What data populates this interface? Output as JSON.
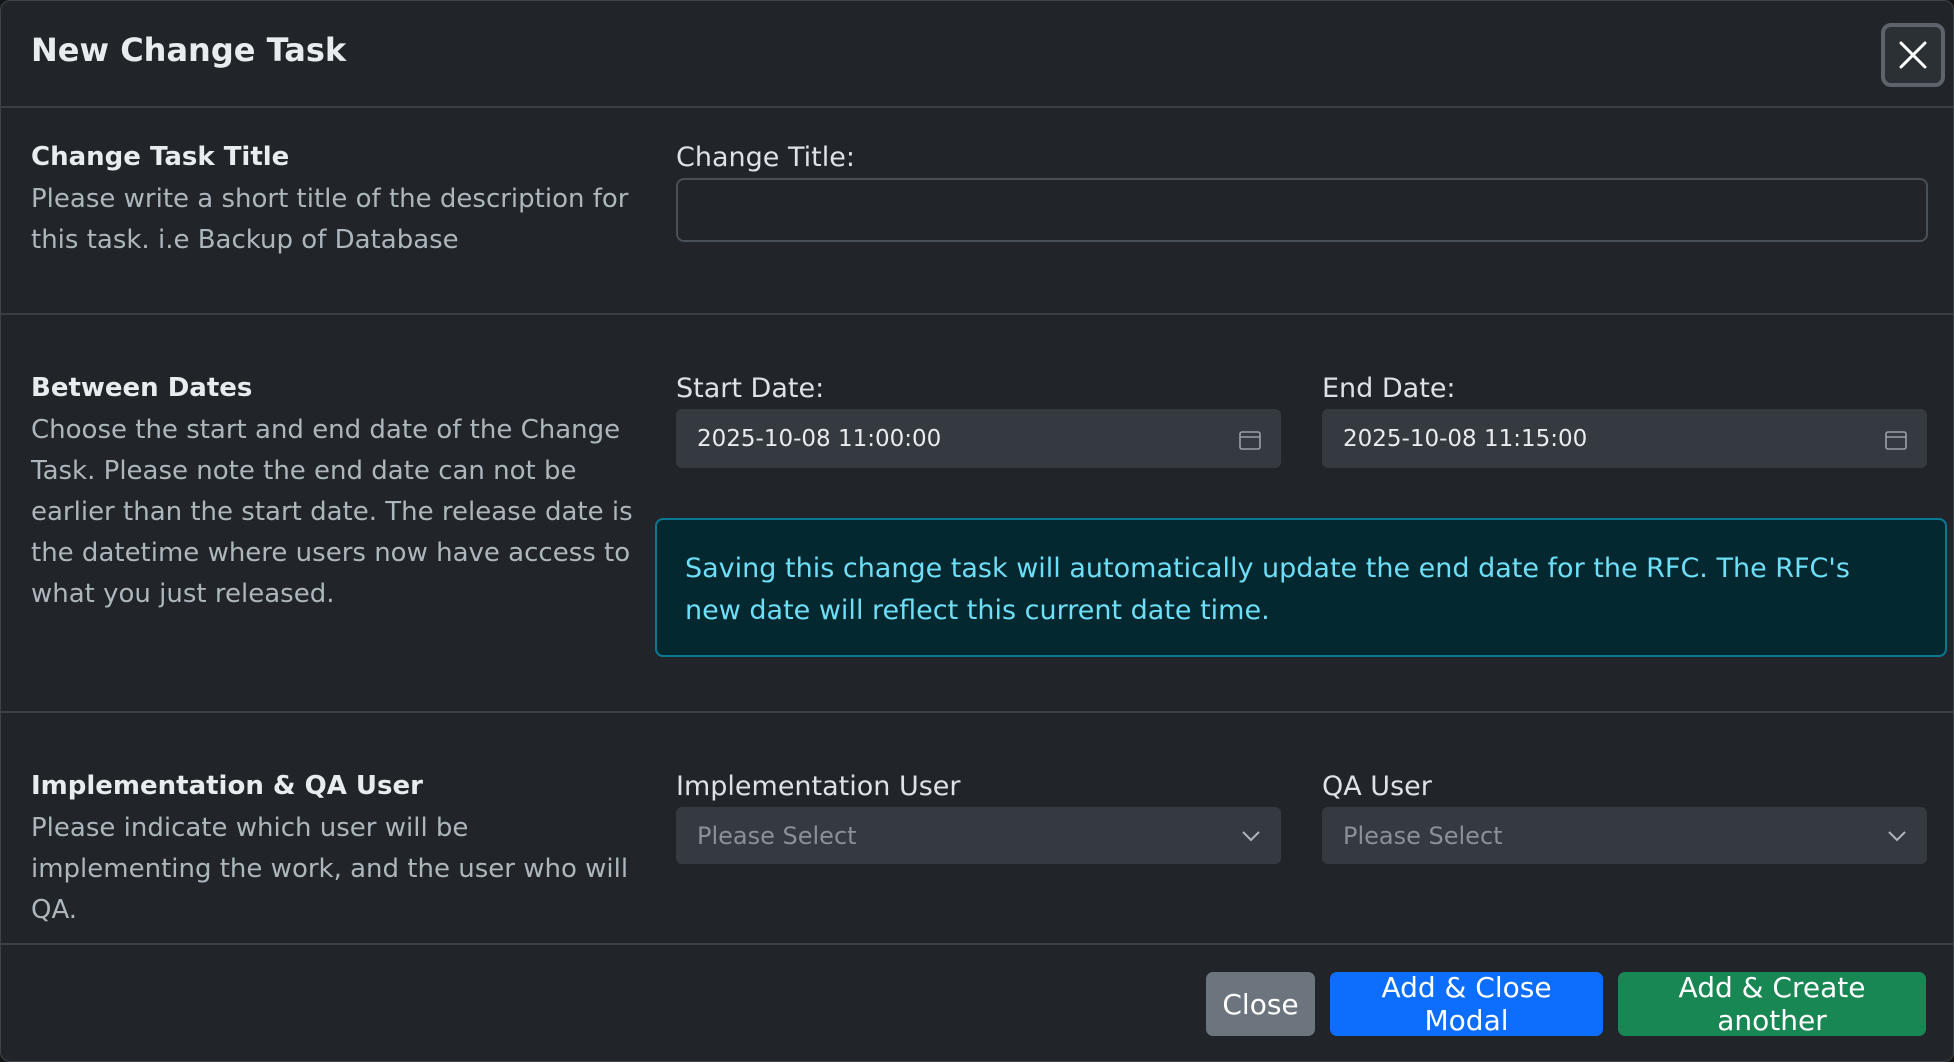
{
  "modal": {
    "title": "New Change Task"
  },
  "sections": {
    "title_section": {
      "heading": "Change Task Title",
      "description": "Please write a short title of the description for this task. i.e Backup of Database",
      "field_label": "Change Title:",
      "field_value": "",
      "field_placeholder": ""
    },
    "dates_section": {
      "heading": "Between Dates",
      "description": "Choose the start and end date of the Change Task. Please note the end date can not be earlier than the start date. The release date is the datetime where users now have access to what you just released.",
      "start_label": "Start Date:",
      "start_value": "2025-10-08 11:00:00",
      "end_label": "End Date:",
      "end_value": "2025-10-08 11:15:00",
      "alert_text": "Saving this change task will automatically update the end date for the RFC. The RFC's new date will reflect this current date time."
    },
    "users_section": {
      "heading": "Implementation & QA User",
      "description": "Please indicate which user will be implementing the work, and the user who will QA.",
      "impl_label": "Implementation User",
      "impl_value": "Please Select",
      "qa_label": "QA User",
      "qa_value": "Please Select"
    }
  },
  "footer": {
    "close_label": "Close",
    "add_close_label": "Add & Close Modal",
    "add_another_label": "Add & Create another"
  },
  "icons": {
    "close": "close-icon",
    "calendar": "calendar-icon",
    "chevron": "chevron-down-icon"
  },
  "colors": {
    "primary": "#0d6efd",
    "success": "#198754",
    "secondary": "#6c757d",
    "info_text": "#6edff6",
    "info_bg": "#032830"
  }
}
